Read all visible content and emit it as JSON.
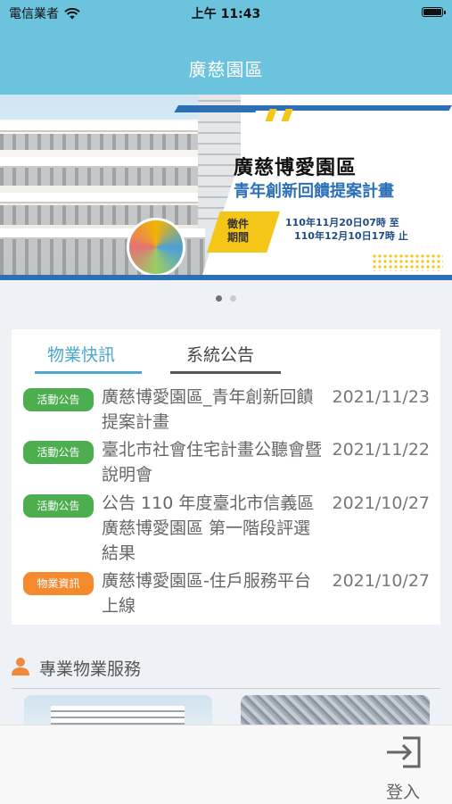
{
  "status_bar": {
    "carrier": "電信業者",
    "time": "上午 11:43"
  },
  "header": {
    "title": "廣慈園區"
  },
  "banner": {
    "title": "廣慈博愛園區",
    "subtitle": "青年創新回饋提案計畫",
    "tag_line1": "徵件",
    "tag_line2": "期間",
    "period_start": "110年11月20日07時 至",
    "period_end": "110年12月10日17時 止",
    "page_count": 2,
    "active_page": 1
  },
  "tabs": [
    {
      "label": "物業快訊",
      "active": true
    },
    {
      "label": "系統公告",
      "active": false
    }
  ],
  "news": [
    {
      "badge": "活動公告",
      "badge_color": "#4cae4f",
      "title": "廣慈博愛園區_青年創新回饋提案計畫",
      "date": "2021/11/23"
    },
    {
      "badge": "活動公告",
      "badge_color": "#4cae4f",
      "title": "臺北市社會住宅計畫公聽會暨說明會",
      "date": "2021/11/22"
    },
    {
      "badge": "活動公告",
      "badge_color": "#4cae4f",
      "title": "公告 110 年度臺北市信義區廣慈博愛園區 第一階段評選結果",
      "date": "2021/10/27"
    },
    {
      "badge": "物業資訊",
      "badge_color": "#f5892e",
      "title": "廣慈博愛園區-住戶服務平台上線",
      "date": "2021/10/27"
    }
  ],
  "section": {
    "title": "專業物業服務",
    "icon": "person-icon"
  },
  "tabbar": {
    "login_label": "登入",
    "login_icon": "login-icon"
  },
  "colors": {
    "header": "#6cc3dd",
    "accent": "#4ca7cc",
    "badge_event": "#4cae4f",
    "badge_property": "#f5892e"
  }
}
